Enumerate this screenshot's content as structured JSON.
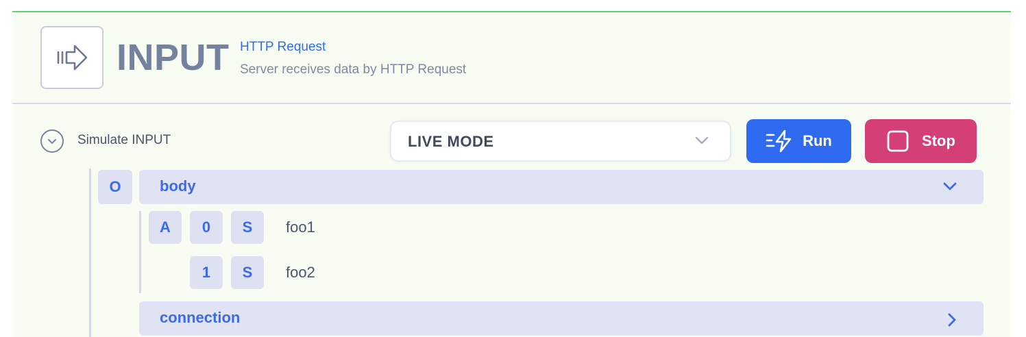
{
  "node": {
    "icon": "input-arrow-icon",
    "title": "INPUT",
    "subtitle": "HTTP Request",
    "description": "Server receives data by HTTP Request"
  },
  "simulate": {
    "label": "Simulate INPUT",
    "mode": {
      "selected": "LIVE MODE"
    },
    "run_label": "Run",
    "stop_label": "Stop"
  },
  "tree": {
    "root_type": "O",
    "fields": [
      {
        "label": "body",
        "expanded": true,
        "array_type": "A",
        "items": [
          {
            "index": "0",
            "type": "S",
            "value": "foo1"
          },
          {
            "index": "1",
            "type": "S",
            "value": "foo2"
          }
        ]
      },
      {
        "label": "connection",
        "expanded": false
      }
    ]
  },
  "colors": {
    "accent": "#2e6bf0",
    "stop": "#d43f78",
    "border_top": "#5fcf6a",
    "background": "#f7fdf3"
  }
}
